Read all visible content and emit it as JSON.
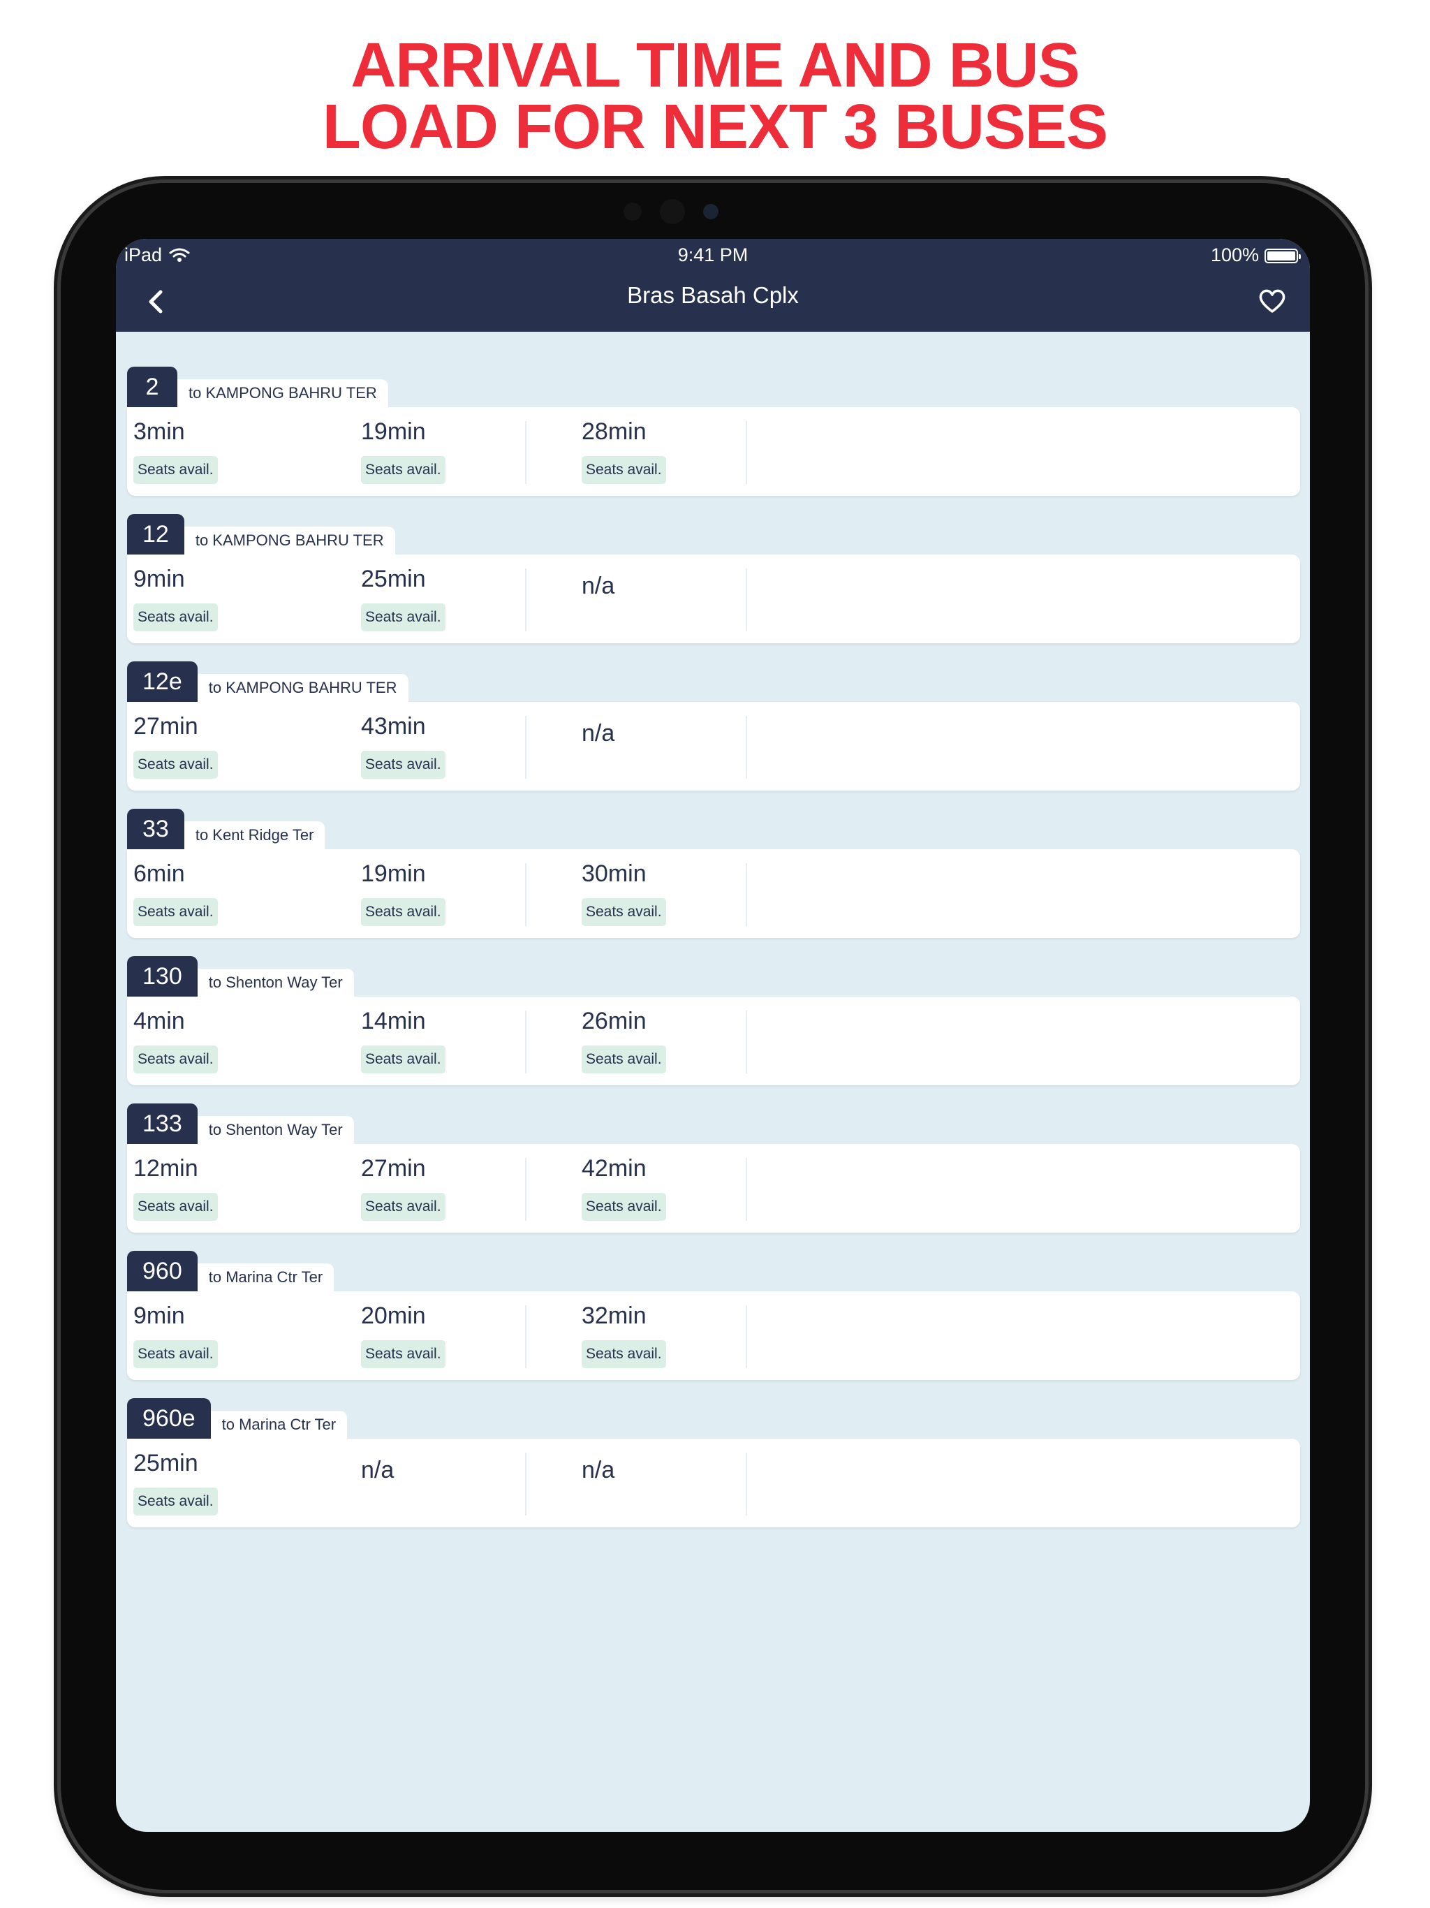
{
  "headline": {
    "line1": "ARRIVAL TIME AND BUS",
    "line2": "LOAD FOR NEXT 3 BUSES"
  },
  "status_bar": {
    "device": "iPad",
    "time": "9:41 PM",
    "battery": "100%"
  },
  "nav": {
    "title": "Bras Basah Cplx",
    "back_icon": "chevron-left-icon",
    "favorite_icon": "heart-outline-icon"
  },
  "colors": {
    "headline": "#ee2d3b",
    "navbar": "#27314d",
    "background": "#e0edf3",
    "seats_badge": "#dbefe7"
  },
  "services": [
    {
      "route": "2",
      "destination": "to KAMPONG BAHRU TER",
      "arrivals": [
        {
          "time": "3min",
          "load": "Seats avail."
        },
        {
          "time": "19min",
          "load": "Seats avail."
        },
        {
          "time": "28min",
          "load": "Seats avail."
        }
      ]
    },
    {
      "route": "12",
      "destination": "to KAMPONG BAHRU TER",
      "arrivals": [
        {
          "time": "9min",
          "load": "Seats avail."
        },
        {
          "time": "25min",
          "load": "Seats avail."
        },
        {
          "time": "n/a",
          "load": null
        }
      ]
    },
    {
      "route": "12e",
      "destination": "to KAMPONG BAHRU TER",
      "arrivals": [
        {
          "time": "27min",
          "load": "Seats avail."
        },
        {
          "time": "43min",
          "load": "Seats avail."
        },
        {
          "time": "n/a",
          "load": null
        }
      ]
    },
    {
      "route": "33",
      "destination": "to Kent Ridge Ter",
      "arrivals": [
        {
          "time": "6min",
          "load": "Seats avail."
        },
        {
          "time": "19min",
          "load": "Seats avail."
        },
        {
          "time": "30min",
          "load": "Seats avail."
        }
      ]
    },
    {
      "route": "130",
      "destination": "to Shenton Way Ter",
      "arrivals": [
        {
          "time": "4min",
          "load": "Seats avail."
        },
        {
          "time": "14min",
          "load": "Seats avail."
        },
        {
          "time": "26min",
          "load": "Seats avail."
        }
      ]
    },
    {
      "route": "133",
      "destination": "to Shenton Way Ter",
      "arrivals": [
        {
          "time": "12min",
          "load": "Seats avail."
        },
        {
          "time": "27min",
          "load": "Seats avail."
        },
        {
          "time": "42min",
          "load": "Seats avail."
        }
      ]
    },
    {
      "route": "960",
      "destination": "to Marina Ctr Ter",
      "arrivals": [
        {
          "time": "9min",
          "load": "Seats avail."
        },
        {
          "time": "20min",
          "load": "Seats avail."
        },
        {
          "time": "32min",
          "load": "Seats avail."
        }
      ]
    },
    {
      "route": "960e",
      "destination": "to Marina Ctr Ter",
      "arrivals": [
        {
          "time": "25min",
          "load": "Seats avail."
        },
        {
          "time": "n/a",
          "load": null
        },
        {
          "time": "n/a",
          "load": null
        }
      ]
    }
  ]
}
